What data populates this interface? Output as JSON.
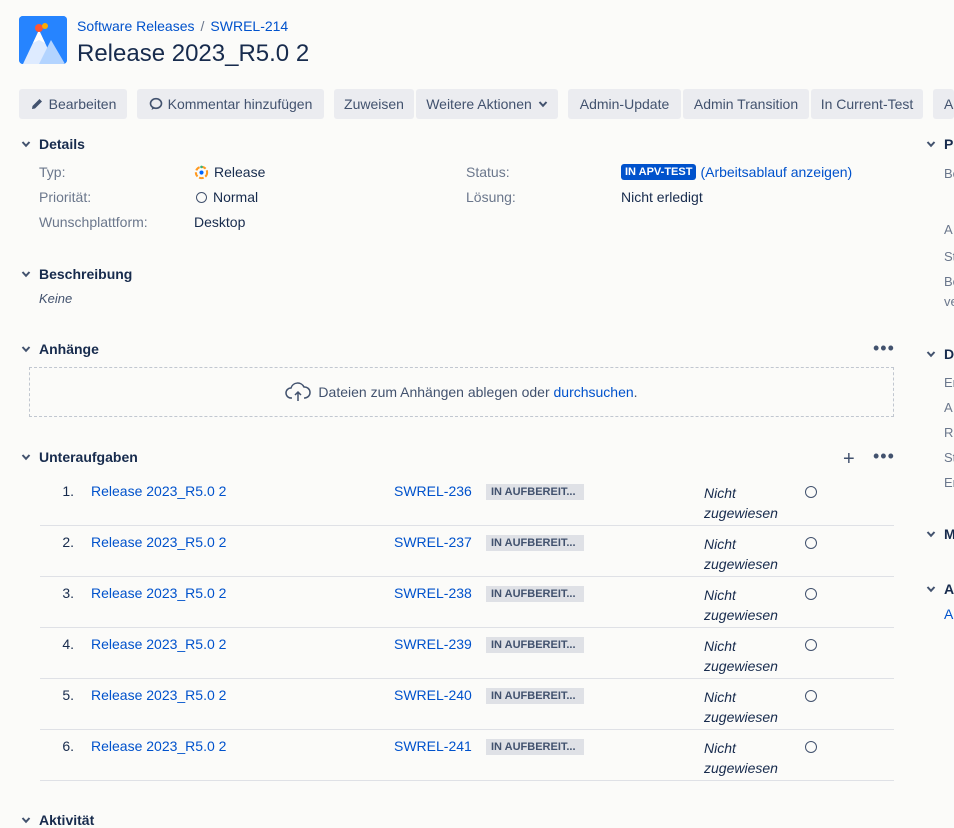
{
  "header": {
    "breadcrumb_project": "Software Releases",
    "breadcrumb_sep": "/",
    "breadcrumb_issue": "SWREL-214",
    "title": "Release 2023_R5.0 2"
  },
  "toolbar": {
    "edit": "Bearbeiten",
    "comment": "Kommentar hinzufügen",
    "assign": "Zuweisen",
    "more_actions": "Weitere Aktionen",
    "admin_update": "Admin-Update",
    "admin_transition": "Admin Transition",
    "in_current_test": "In Current-Test",
    "clipped": "A"
  },
  "details": {
    "heading": "Details",
    "type_label": "Typ:",
    "type_value": "Release",
    "priority_label": "Priorität:",
    "priority_value": "Normal",
    "platform_label": "Wunschplattform:",
    "platform_value": "Desktop",
    "status_label": "Status:",
    "status_value": "IN APV-TEST",
    "workflow_link": "(Arbeitsablauf anzeigen)",
    "resolution_label": "Lösung:",
    "resolution_value": "Nicht erledigt"
  },
  "description": {
    "heading": "Beschreibung",
    "value": "Keine"
  },
  "attachments": {
    "heading": "Anhänge",
    "drop_text": "Dateien zum Anhängen ablegen oder",
    "browse_link": "durchsuchen",
    "drop_end": "."
  },
  "subtasks": {
    "heading": "Unteraufgaben",
    "rows": [
      {
        "num": "1.",
        "summary": "Release 2023_R5.0 2",
        "key": "SWREL-236",
        "status": "IN AUFBEREIT...",
        "assignee": "Nicht zugewiesen"
      },
      {
        "num": "2.",
        "summary": "Release 2023_R5.0 2",
        "key": "SWREL-237",
        "status": "IN AUFBEREIT...",
        "assignee": "Nicht zugewiesen"
      },
      {
        "num": "3.",
        "summary": "Release 2023_R5.0 2",
        "key": "SWREL-238",
        "status": "IN AUFBEREIT...",
        "assignee": "Nicht zugewiesen"
      },
      {
        "num": "4.",
        "summary": "Release 2023_R5.0 2",
        "key": "SWREL-239",
        "status": "IN AUFBEREIT...",
        "assignee": "Nicht zugewiesen"
      },
      {
        "num": "5.",
        "summary": "Release 2023_R5.0 2",
        "key": "SWREL-240",
        "status": "IN AUFBEREIT...",
        "assignee": "Nicht zugewiesen"
      },
      {
        "num": "6.",
        "summary": "Release 2023_R5.0 2",
        "key": "SWREL-241",
        "status": "IN AUFBEREIT...",
        "assignee": "Nicht zugewiesen"
      }
    ]
  },
  "activity": {
    "heading": "Aktivität"
  },
  "right_column": {
    "people_heading": "Pe",
    "b1": "Be",
    "a1": "A",
    "s1": "St",
    "b2": "Be",
    "v1": "ve",
    "dates_heading": "D",
    "e1": "Er",
    "a2": "A",
    "r1": "Re",
    "s2": "St",
    "e2": "Er",
    "m_heading": "M",
    "a_heading": "A",
    "a_link": "A"
  },
  "colors": {
    "link": "#0052cc",
    "status_blue": "#0052cc",
    "lozenge_grey": "#dfe1e6"
  },
  "icons": [
    "project-mountain-icon",
    "pencil-icon",
    "comment-icon",
    "chevron-down-icon",
    "release-type-icon",
    "priority-normal-icon",
    "upload-cloud-icon",
    "plus-icon",
    "more-icon"
  ]
}
